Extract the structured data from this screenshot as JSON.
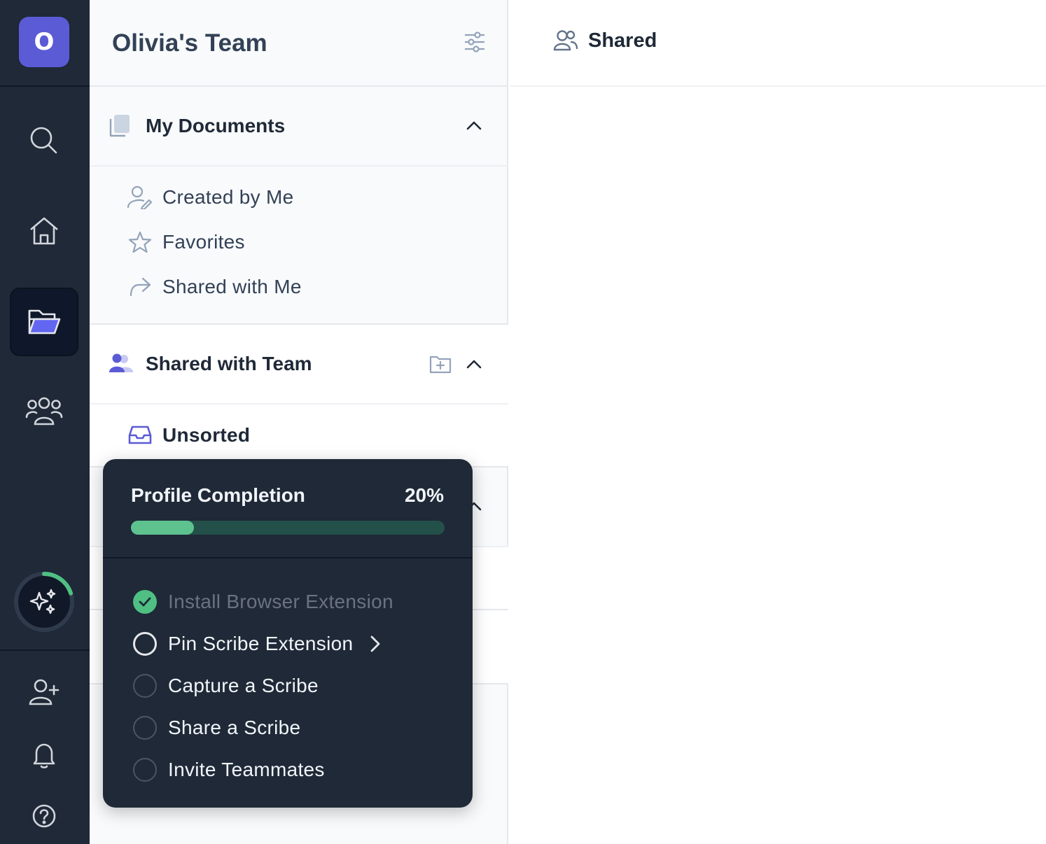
{
  "rail": {
    "avatar_letter": "O",
    "nav": [
      {
        "name": "search",
        "icon": "search-icon"
      },
      {
        "name": "home",
        "icon": "home-icon"
      },
      {
        "name": "documents",
        "icon": "folder-open-icon",
        "active": true
      },
      {
        "name": "teams",
        "icon": "users-icon"
      }
    ],
    "ai_button_icon": "sparkles-icon",
    "bottom": [
      {
        "name": "invite",
        "icon": "user-plus-icon"
      },
      {
        "name": "notifications",
        "icon": "bell-icon"
      },
      {
        "name": "help",
        "icon": "help-circle-icon"
      }
    ],
    "progress_ring": 0.2
  },
  "sidebar": {
    "team_name": "Olivia's Team",
    "my_documents": {
      "title": "My Documents",
      "items": [
        {
          "label": "Created by Me",
          "icon": "user-edit-icon"
        },
        {
          "label": "Favorites",
          "icon": "star-icon"
        },
        {
          "label": "Shared with Me",
          "icon": "share-arrow-icon"
        }
      ]
    },
    "shared_with_team": {
      "title": "Shared with Team",
      "items": [
        {
          "label": "Unsorted",
          "icon": "inbox-icon"
        }
      ]
    }
  },
  "main": {
    "title": "Shared",
    "icon": "users-icon"
  },
  "profile_completion": {
    "title": "Profile Completion",
    "percent_label": "20%",
    "progress": 0.2,
    "tasks": [
      {
        "label": "Install Browser Extension",
        "status": "done"
      },
      {
        "label": "Pin Scribe Extension",
        "status": "current"
      },
      {
        "label": "Capture a Scribe",
        "status": "todo"
      },
      {
        "label": "Share a Scribe",
        "status": "todo"
      },
      {
        "label": "Invite Teammates",
        "status": "todo"
      }
    ]
  },
  "colors": {
    "rail_bg": "#1f2937",
    "accent": "#5b5bd6",
    "progress": "#5ec28f"
  }
}
